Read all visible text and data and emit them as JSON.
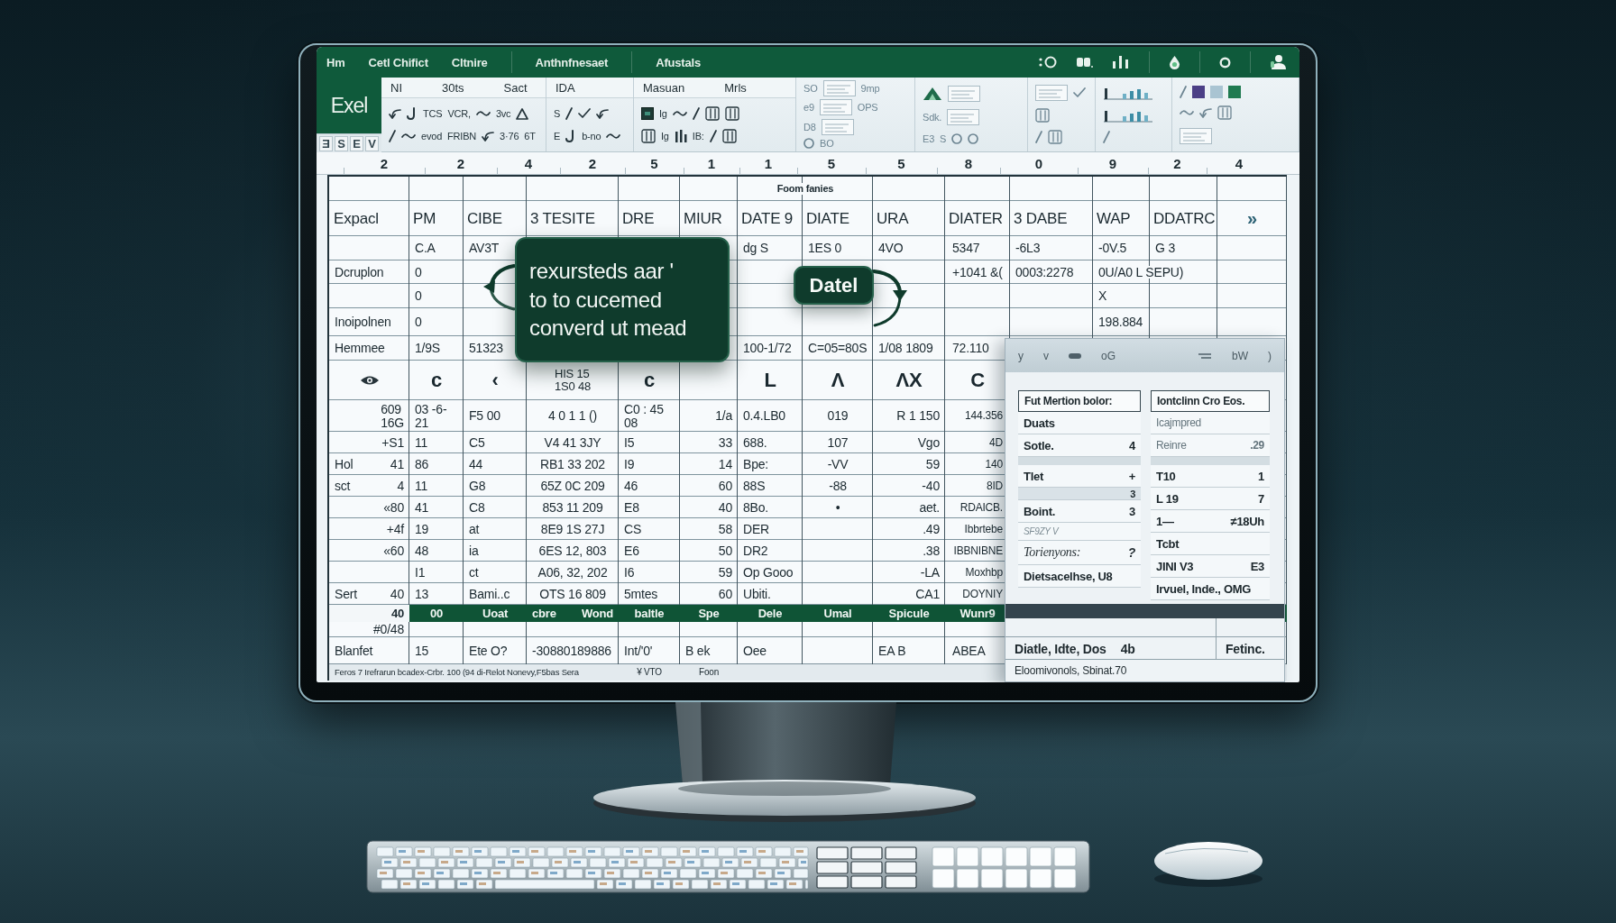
{
  "title_bar": {
    "items": [
      "Hm",
      "Cetl Chifict",
      "Cltnire",
      "Anthnfnesaet",
      "Afustals"
    ]
  },
  "ribbon": {
    "app_name": "Exel",
    "view_buttons": [
      "Ǝ",
      "S",
      "E",
      "V"
    ],
    "groups": [
      {
        "labels": [
          "NI",
          "30ts",
          "Sact"
        ],
        "rows": [
          [
            {
              "kind": "icon"
            },
            {
              "kind": "icon"
            },
            {
              "kind": "text",
              "text": "TCS"
            },
            {
              "kind": "text",
              "text": "VCR,"
            },
            {
              "kind": "icon"
            },
            {
              "kind": "text",
              "text": "3vc"
            },
            {
              "kind": "icon"
            }
          ],
          [
            {
              "kind": "icon"
            },
            {
              "kind": "icon"
            },
            {
              "kind": "text",
              "text": "evod"
            },
            {
              "kind": "text",
              "text": "FRIBN"
            },
            {
              "kind": "icon"
            },
            {
              "kind": "text",
              "text": "3·76"
            },
            {
              "kind": "text",
              "text": "6T"
            }
          ]
        ]
      },
      {
        "labels": [
          "IDA"
        ],
        "rows": [
          [
            {
              "kind": "text",
              "text": "S"
            },
            {
              "kind": "icon"
            },
            {
              "kind": "icon"
            },
            {
              "kind": "icon"
            }
          ],
          [
            {
              "kind": "text",
              "text": "E"
            },
            {
              "kind": "icon"
            },
            {
              "kind": "text",
              "text": "b-no"
            },
            {
              "kind": "icon"
            }
          ]
        ]
      },
      {
        "labels": [
          "Masuan",
          "Mrls"
        ],
        "rows": [
          [
            {
              "kind": "icon"
            },
            {
              "kind": "text",
              "text": "Ig"
            },
            {
              "kind": "icon"
            },
            {
              "kind": "icon"
            },
            {
              "kind": "icon"
            },
            {
              "kind": "icon"
            }
          ],
          [
            {
              "kind": "icon"
            },
            {
              "kind": "text",
              "text": "Ig"
            },
            {
              "kind": "icon"
            },
            {
              "kind": "text",
              "text": "IB:"
            },
            {
              "kind": "icon"
            },
            {
              "kind": "icon"
            }
          ]
        ]
      },
      {
        "rows": [
          [
            {
              "kind": "text",
              "text": "SO"
            },
            {
              "kind": "icon"
            },
            {
              "kind": "text",
              "text": "9mp"
            }
          ],
          [
            {
              "kind": "text",
              "text": "e9"
            },
            {
              "kind": "icon"
            },
            {
              "kind": "text",
              "text": "OPS"
            }
          ],
          [
            {
              "kind": "text",
              "text": "D8"
            },
            {
              "kind": "icon"
            }
          ],
          [
            {
              "kind": "icon"
            },
            {
              "kind": "text",
              "text": "BO"
            }
          ]
        ]
      },
      {
        "rows": [
          [
            {
              "kind": "icon"
            },
            {
              "kind": "icon"
            }
          ],
          [
            {
              "kind": "text",
              "text": "Sdk."
            },
            {
              "kind": "icon"
            }
          ],
          [
            {
              "kind": "text",
              "text": "E3"
            },
            {
              "kind": "text",
              "text": "S"
            },
            {
              "kind": "icon"
            },
            {
              "kind": "icon"
            }
          ]
        ]
      },
      {
        "rows": [
          [
            {
              "kind": "icon"
            },
            {
              "kind": "icon"
            }
          ],
          [
            {
              "kind": "icon"
            }
          ],
          [
            {
              "kind": "icon"
            },
            {
              "kind": "icon"
            }
          ]
        ]
      },
      {
        "rows": [
          [
            {
              "kind": "icon"
            }
          ],
          [
            {
              "kind": "icon"
            }
          ],
          [
            {
              "kind": "icon"
            }
          ]
        ]
      },
      {
        "rows": [
          [
            {
              "kind": "icon"
            },
            {
              "kind": "swatch",
              "color": "#4b3f86"
            },
            {
              "kind": "swatch",
              "color": "#a9c4d2"
            },
            {
              "kind": "swatch",
              "color": "#1f7a50"
            }
          ],
          [
            {
              "kind": "icon"
            },
            {
              "kind": "icon"
            },
            {
              "kind": "icon"
            }
          ],
          [
            {
              "kind": "icon"
            }
          ]
        ]
      }
    ]
  },
  "column_ruler": [
    "2",
    "2",
    "4",
    "2",
    "5",
    "1",
    "1",
    "5",
    "5",
    "8",
    "0",
    "9",
    "2",
    "4"
  ],
  "sheet": {
    "title": "Foom fanies",
    "header": [
      "Expacl",
      "PM",
      "CIBE",
      "3 TESITE",
      "DRE",
      "MIUR",
      "DATE 9",
      "DIATE",
      "URA",
      "DIATER",
      "3 DABE",
      "WAP",
      "DDATRC",
      "»"
    ],
    "rows": [
      {
        "kind": "data",
        "cells": [
          null,
          "C.A",
          "AV3T",
          null,
          null,
          null,
          "dg S",
          "1ES 0",
          "4VO",
          "5347",
          "-6L3",
          "-0V.5",
          "G 3"
        ]
      },
      {
        "kind": "data",
        "cells": [
          "Dcruplon",
          "0",
          null,
          null,
          null,
          null,
          null,
          null,
          null,
          "+1041 &(",
          "0003:2278",
          "0U/A0 L SEPU)"
        ]
      },
      {
        "kind": "data",
        "cells": [
          null,
          "0",
          null,
          null,
          null,
          null,
          null,
          null,
          null,
          null,
          null,
          "X"
        ]
      },
      {
        "kind": "data",
        "cells": [
          "Inoipolnen",
          "0",
          null,
          null,
          null,
          null,
          null,
          null,
          null,
          null,
          null,
          "198.884"
        ]
      },
      {
        "kind": "data",
        "cells": [
          "Hemmee",
          "1/9S",
          "51323",
          null,
          null,
          null,
          "100-1/72",
          "C=05=80S",
          "1/08 1809",
          "72.110"
        ]
      },
      {
        "kind": "glyphs",
        "cells": [
          null,
          "c",
          "‹",
          "HIS 15\n1S0 48",
          "c",
          null,
          "L",
          "Λ",
          "ΛX",
          "C"
        ]
      },
      {
        "kind": "figures",
        "cells": [
          "609\n16G",
          "03 -6-\n21",
          "F5 00",
          "4 0 1 1 ()",
          "C0 : 45\n08",
          "1/a",
          "0.4.LB0",
          "019",
          "R 1 150",
          "144.356"
        ]
      },
      {
        "kind": "figures",
        "cells": [
          "+S1",
          "11",
          "C5",
          "V4 41 3JY",
          "I5",
          "33",
          "688.",
          "107",
          "Vgo",
          "4D"
        ]
      },
      {
        "kind": "figures",
        "cells": [
          [
            "Hol",
            "41"
          ],
          "86",
          "44",
          "RB1 33 202",
          "I9",
          "14",
          "Bpe:",
          "-VV",
          "59",
          "140"
        ]
      },
      {
        "kind": "figures",
        "cells": [
          [
            "sct",
            "4"
          ],
          "11",
          "G8",
          "65Z 0C 209",
          "46",
          "60",
          "88S",
          "-88",
          "-40",
          "8ID"
        ]
      },
      {
        "kind": "figures",
        "cells": [
          "«80",
          "41",
          "C8",
          "853 11 209",
          "E8",
          "40",
          "8Bo.",
          "•",
          "aet.",
          "RDAICB."
        ]
      },
      {
        "kind": "figures",
        "cells": [
          "+4f",
          "19",
          "at",
          "8E9 1S 27J",
          "CS",
          "58",
          "DER",
          null,
          ".49",
          "Ibbrtebe"
        ]
      },
      {
        "kind": "figures",
        "cells": [
          "«60",
          "48",
          "ia",
          "6ES 12, 803",
          "E6",
          "50",
          "DR2",
          null,
          ".38",
          "IBBNIBNE"
        ]
      },
      {
        "kind": "figures",
        "cells": [
          null,
          "I1",
          "ct",
          "A06, 32, 202",
          "I6",
          "59",
          "Op Gooo",
          null,
          "-LA",
          "Moxhbp"
        ]
      },
      {
        "kind": "figures",
        "cells": [
          [
            "Sert",
            "40"
          ],
          "13",
          "Bami..c",
          "OTS 16 809",
          "5mtes",
          "60",
          "Ubiti.",
          null,
          "CA1",
          "DOYNIY"
        ]
      },
      {
        "kind": "band",
        "cells": [
          "40",
          "00",
          "Uoat",
          [
            "cbre",
            "Wond"
          ],
          "baltle",
          "Spe",
          "Dele",
          "Umal",
          "Spicule",
          "Wunr9"
        ]
      },
      {
        "kind": "figures",
        "cells": [
          "#0/48"
        ]
      },
      {
        "kind": "data",
        "cells": [
          "Blanfet",
          "15",
          "Ete O?",
          "-30880189886",
          "Int/'0'",
          "B ek",
          "Oee",
          null,
          "EA B",
          "ABEA"
        ]
      }
    ],
    "status": {
      "left": "Feros 7 Irefrarun bcadex-Crbr. 100 (94 di-Relot Nonevy,F5bas Sera",
      "items": [
        "¥ VTO",
        "Foon"
      ]
    }
  },
  "callouts": [
    {
      "kind": "note",
      "lines": [
        "rexursteds aar '",
        "to to cucemed",
        "converd ut mead"
      ]
    },
    {
      "kind": "tag",
      "lines": [
        "Datel"
      ]
    }
  ],
  "panel": {
    "header": {
      "left": [
        "y",
        "v",
        "oG"
      ],
      "right": [
        "bW",
        ")"
      ]
    },
    "lists": [
      {
        "items": [
          {
            "kind": "head",
            "label": "Fut Mertion bolor:"
          },
          {
            "kind": "plain",
            "label": "Duats"
          },
          {
            "kind": "plain",
            "label": "Sotle.",
            "value": "4"
          },
          {
            "kind": "gap"
          },
          {
            "kind": "plain",
            "label": "Tlet",
            "value": "+"
          },
          {
            "kind": "strip",
            "value": "3"
          },
          {
            "kind": "plain",
            "label": "Boint.",
            "value": "3"
          },
          {
            "kind": "note",
            "label": "SF9ZY V"
          },
          {
            "kind": "italic",
            "label": "Torienyons:",
            "value": "?"
          },
          {
            "kind": "plain",
            "label": "Dietsacelhse, U8"
          }
        ]
      },
      {
        "items": [
          {
            "kind": "head",
            "label": "Iontclinn Cro Eos."
          },
          {
            "kind": "muted",
            "label": "Icajmpred"
          },
          {
            "kind": "muted",
            "label": "Reinre",
            "value": ".29"
          },
          {
            "kind": "gap"
          },
          {
            "kind": "plain",
            "label": "T10",
            "value": "1"
          },
          {
            "kind": "plain",
            "label": "L 19",
            "value": "7"
          },
          {
            "kind": "plain",
            "label": "1—",
            "value": "≠18Uh"
          },
          {
            "kind": "plain",
            "label": "Tcbt"
          },
          {
            "kind": "plain",
            "label": "JINI V3",
            "value": "E3"
          },
          {
            "kind": "plain",
            "label": "Irvuel, Inde., OMG"
          }
        ]
      }
    ],
    "footer": {
      "left": [
        "Diatle, Idte, Dos",
        "4b"
      ],
      "right": "Fetinc.",
      "note": "Eloomivonols, Sbinat.70"
    }
  }
}
